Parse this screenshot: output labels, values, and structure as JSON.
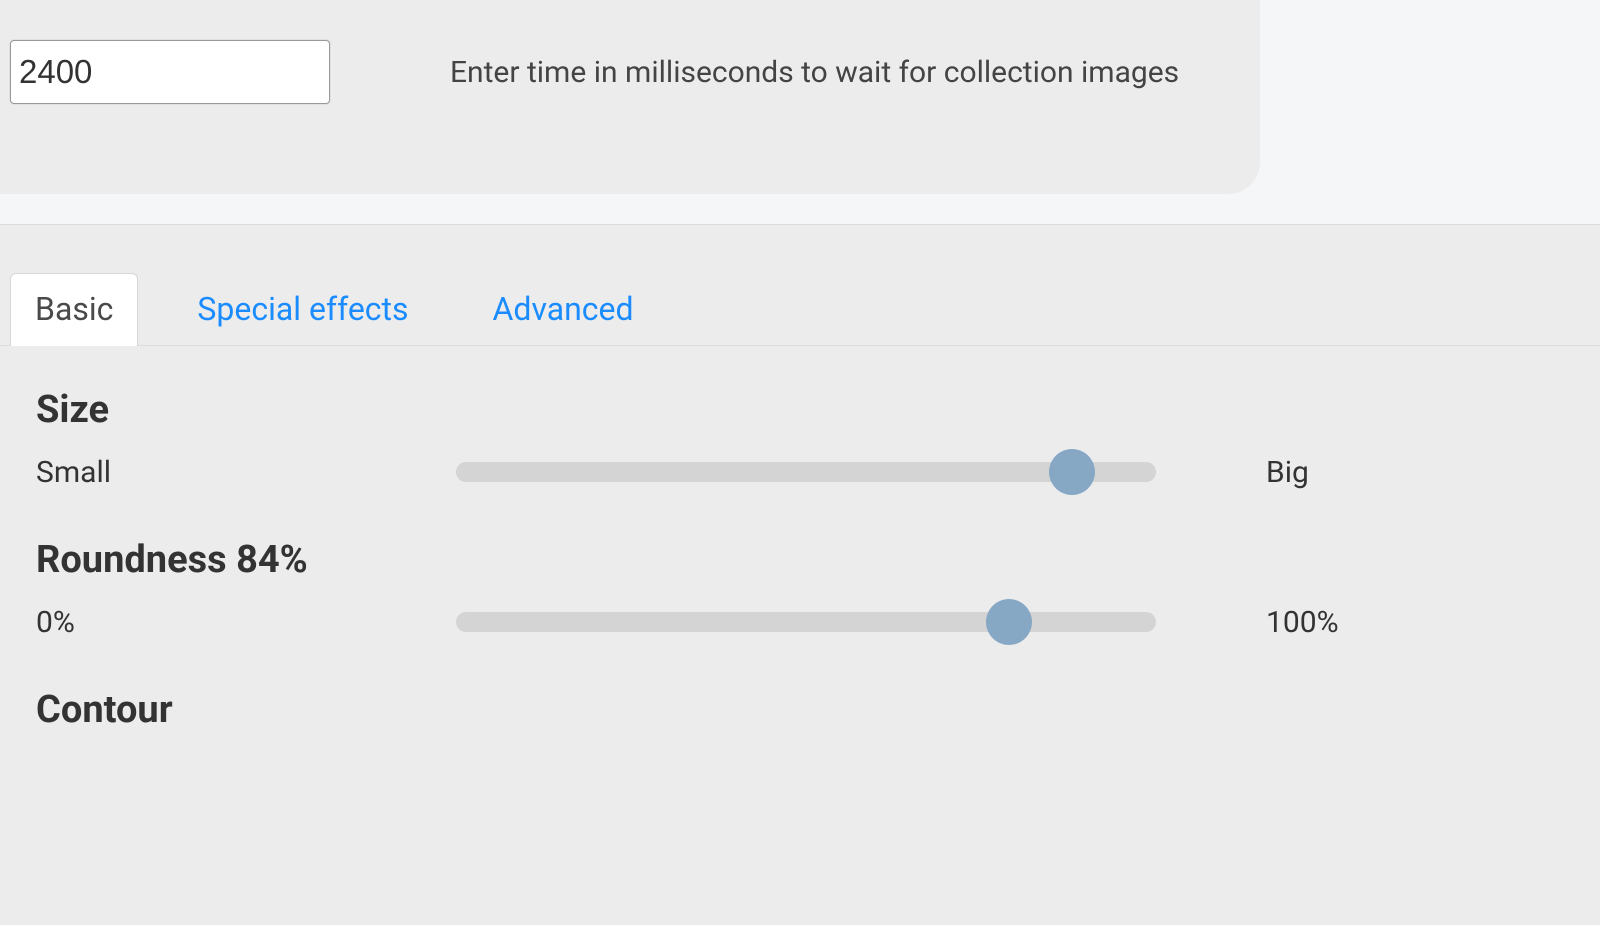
{
  "upper": {
    "time_value": "2400",
    "time_hint": "Enter time in milliseconds to wait for collection images"
  },
  "tabs": [
    {
      "label": "Basic",
      "active": true
    },
    {
      "label": "Special effects",
      "active": false
    },
    {
      "label": "Advanced",
      "active": false
    }
  ],
  "controls": {
    "size": {
      "title": "Size",
      "left": "Small",
      "right": "Big",
      "pct": 88
    },
    "roundness": {
      "title": "Roundness 84%",
      "left": "0%",
      "right": "100%",
      "pct": 79
    },
    "contour": {
      "title": "Contour"
    }
  }
}
